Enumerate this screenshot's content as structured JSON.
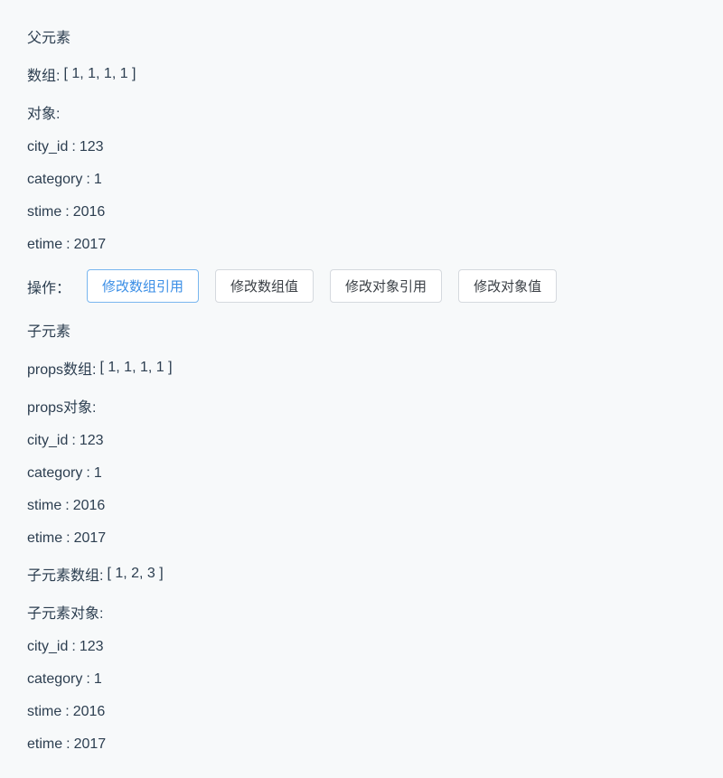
{
  "parent": {
    "title": "父元素",
    "arrayLabel": "数组:",
    "arrayDisplay": "[ 1, 1, 1, 1 ]",
    "objectLabel": "对象:",
    "props": [
      {
        "key": "city_id",
        "value": "123"
      },
      {
        "key": "category",
        "value": "1"
      },
      {
        "key": "stime",
        "value": "2016"
      },
      {
        "key": "etime",
        "value": "2017"
      }
    ],
    "actionsLabel": "操作：",
    "buttons": [
      {
        "label": "修改数组引用",
        "primary": true
      },
      {
        "label": "修改数组值",
        "primary": false
      },
      {
        "label": "修改对象引用",
        "primary": false
      },
      {
        "label": "修改对象值",
        "primary": false
      }
    ]
  },
  "child": {
    "title": "子元素",
    "propsArrayLabel": "props数组:",
    "propsArrayDisplay": "[ 1, 1, 1, 1 ]",
    "propsObjectLabel": "props对象:",
    "propsObject": [
      {
        "key": "city_id",
        "value": "123"
      },
      {
        "key": "category",
        "value": "1"
      },
      {
        "key": "stime",
        "value": "2016"
      },
      {
        "key": "etime",
        "value": "2017"
      }
    ],
    "childArrayLabel": "子元素数组:",
    "childArrayDisplay": "[ 1, 2, 3 ]",
    "childObjectLabel": "子元素对象:",
    "childObject": [
      {
        "key": "city_id",
        "value": "123"
      },
      {
        "key": "category",
        "value": "1"
      },
      {
        "key": "stime",
        "value": "2016"
      },
      {
        "key": "etime",
        "value": "2017"
      }
    ]
  }
}
